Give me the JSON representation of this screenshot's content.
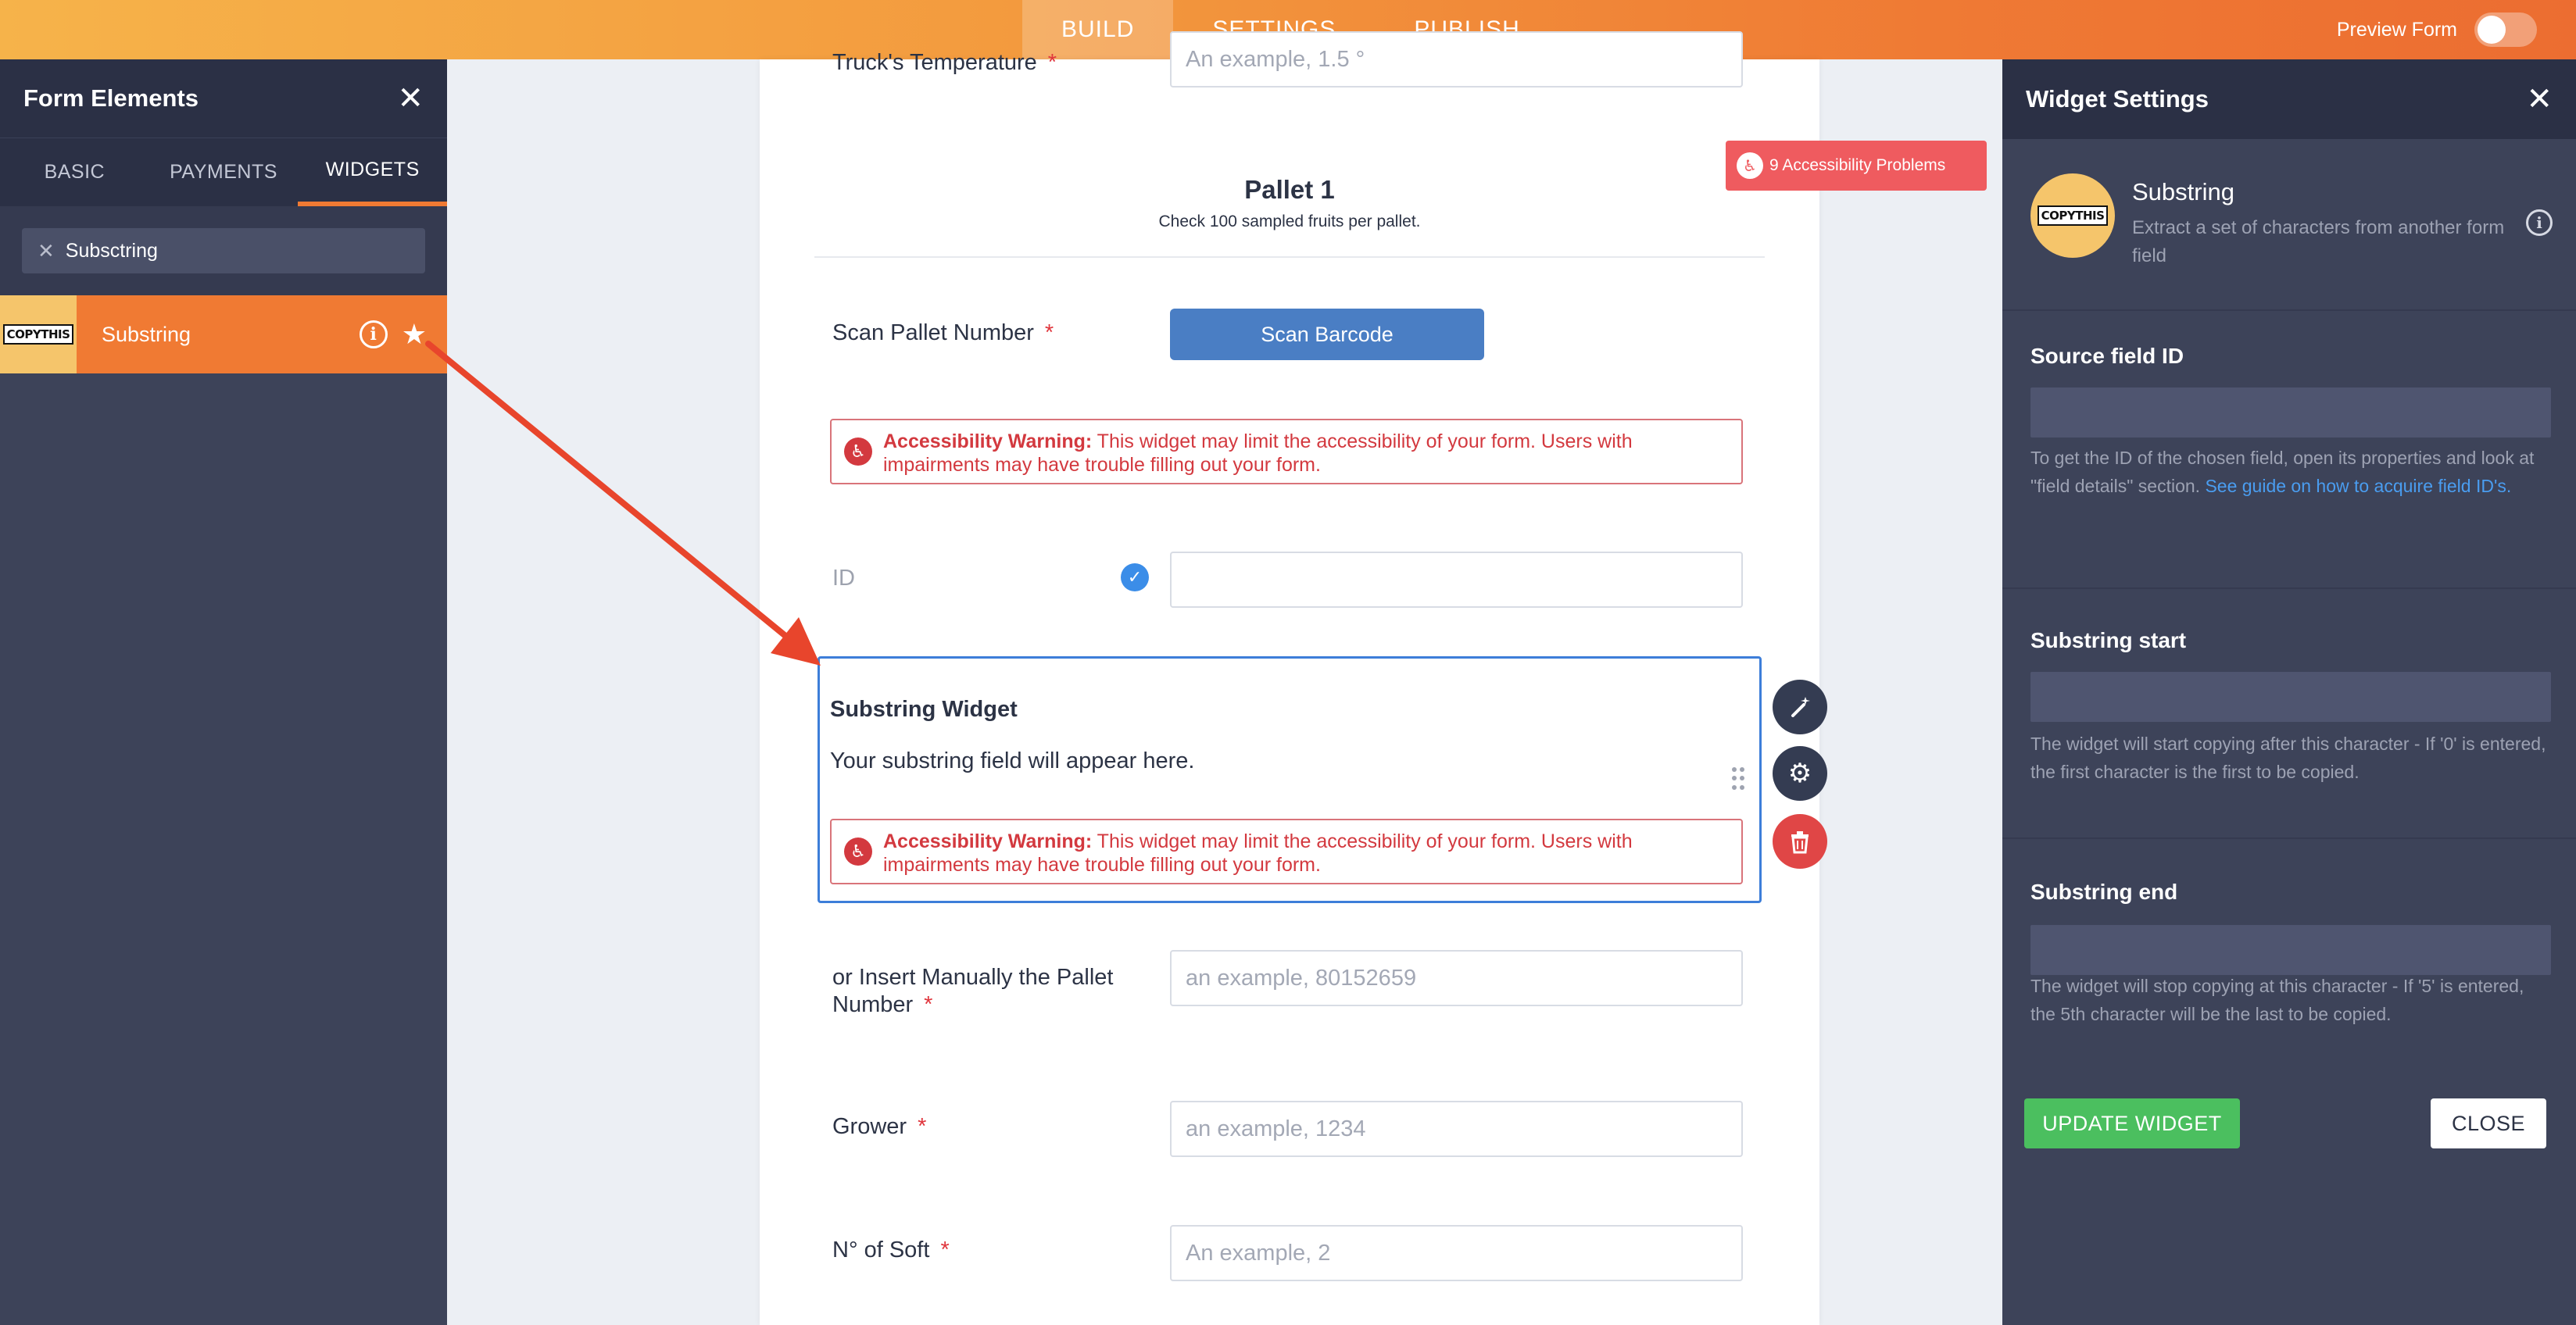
{
  "topbar": {
    "tabs": [
      {
        "label": "BUILD",
        "active": true
      },
      {
        "label": "SETTINGS",
        "active": false
      },
      {
        "label": "PUBLISH",
        "active": false
      }
    ],
    "preview_label": "Preview Form"
  },
  "left_panel": {
    "title": "Form Elements",
    "tabs": [
      "BASIC",
      "PAYMENTS",
      "WIDGETS"
    ],
    "active_tab": "WIDGETS",
    "search_value": "Subsctring",
    "item": {
      "logo_text": "COPYTHIS",
      "name": "Substring"
    }
  },
  "form": {
    "prev_label": "Truck's Temperature",
    "prev_placeholder": "An example, 1.5 °",
    "section_title": "Pallet 1",
    "section_subtitle": "Check 100 sampled fruits per pallet.",
    "scan_label": "Scan Pallet Number",
    "scan_button": "Scan Barcode",
    "warning_bold": "Accessibility Warning:",
    "warning_text": " This widget may limit the accessibility of your form. Users with impairments may have trouble filling out your form.",
    "id_label": "ID",
    "widget_title": "Substring Widget",
    "widget_text": "Your substring field will appear here.",
    "manual_label_1": "or Insert Manually the Pallet",
    "manual_label_2": "Number",
    "manual_placeholder": "an example, 80152659",
    "grower_label": "Grower",
    "grower_placeholder": "an example, 1234",
    "soft_label": "N° of Soft",
    "soft_placeholder": "An example, 2",
    "required_mark": "*",
    "accessibility_badge": "9 Accessibility Problems"
  },
  "right_panel": {
    "title": "Widget Settings",
    "widget_logo": "COPYTHIS",
    "widget_name": "Substring",
    "widget_desc": "Extract a set of characters from another form field",
    "source_label": "Source field ID",
    "source_help": "To get the ID of the chosen field, open its properties and look at \"field details\" section.",
    "source_link": "See guide on how to acquire field ID's.",
    "start_label": "Substring start",
    "start_help": "The widget will start copying after this character - If '0' is entered, the first character is the first to be copied.",
    "end_label": "Substring end",
    "end_help": "The widget will stop copying at this character - If '5' is entered, the 5th character will be the last to be copied.",
    "update_button": "UPDATE WIDGET",
    "close_button": "CLOSE"
  },
  "colors": {
    "accent_orange": "#f07a33",
    "panel_dark": "#3d4359",
    "warning_red": "#d3393f",
    "selected_blue": "#3d7ed9",
    "update_green": "#4bbf5f",
    "arrow_red": "#e8452c"
  },
  "icons": [
    "close-icon",
    "info-icon",
    "star-icon",
    "check-icon",
    "wand-icon",
    "gear-icon",
    "trash-icon",
    "accessibility-icon",
    "drag-handle-icon",
    "arrow-annotation"
  ]
}
